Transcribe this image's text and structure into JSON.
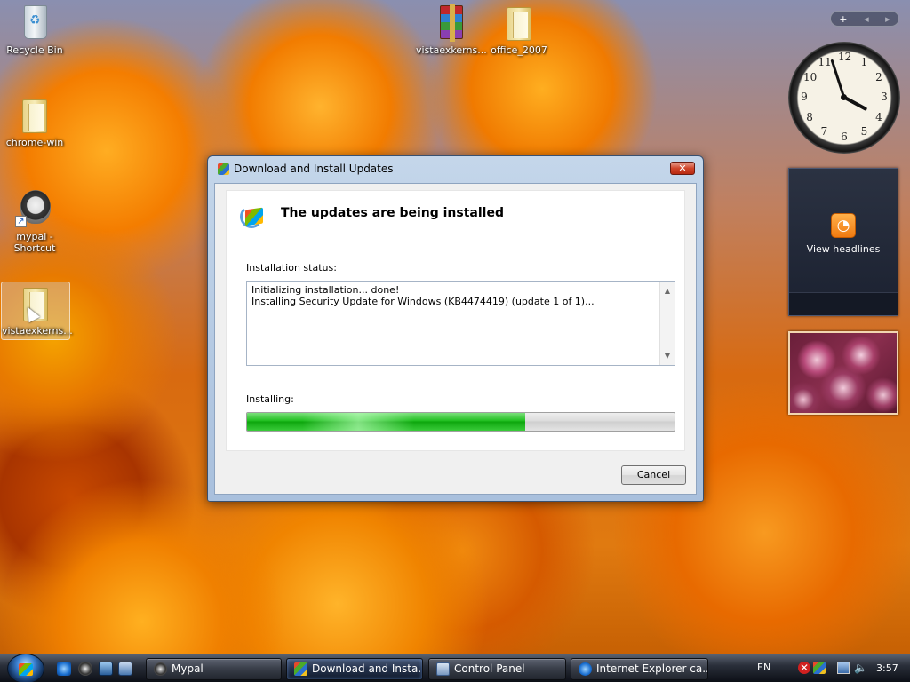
{
  "desktop": {
    "icons": [
      {
        "label": "Recycle Bin",
        "icon": "recycle-bin-icon"
      },
      {
        "label": "chrome-win",
        "icon": "folder-icon"
      },
      {
        "label": "mypal - Shortcut",
        "icon": "raccoon-app-icon"
      },
      {
        "label": "vistaexkerns...",
        "icon": "folder-icon"
      },
      {
        "label": "vistaexkerns...",
        "icon": "winrar-archive-icon"
      },
      {
        "label": "office_2007",
        "icon": "folder-icon"
      }
    ]
  },
  "sidebar": {
    "controls": {
      "add": "+",
      "prev": "◂",
      "next": "▸"
    },
    "clock": {
      "hour": 3,
      "minute": 57,
      "numerals": [
        "12",
        "1",
        "2",
        "3",
        "4",
        "5",
        "6",
        "7",
        "8",
        "9",
        "10",
        "11"
      ]
    },
    "feed_gadget": {
      "label": "View headlines",
      "icon": "rss-icon",
      "accent": "#f07a10"
    }
  },
  "dialog": {
    "title": "Download and Install Updates",
    "close_label": "✕",
    "heading": "The updates are being installed",
    "status_label": "Installation status:",
    "status_lines": [
      "Initializing installation... done!",
      "Installing Security Update for Windows (KB4474419) (update 1 of 1)..."
    ],
    "progress_label": "Installing:",
    "progress_fraction": 0.65,
    "progress_color": "#1fbe1f",
    "cancel_label": "Cancel"
  },
  "taskbar": {
    "tasks": [
      {
        "label": "Mypal",
        "icon": "raccoon-app-icon",
        "active": false
      },
      {
        "label": "Download and Insta...",
        "icon": "windows-update-icon",
        "active": true
      },
      {
        "label": "Control Panel",
        "icon": "control-panel-icon",
        "active": false
      },
      {
        "label": "Internet Explorer ca...",
        "icon": "internet-explorer-icon",
        "active": false
      }
    ],
    "language": "EN",
    "time": "3:57"
  }
}
